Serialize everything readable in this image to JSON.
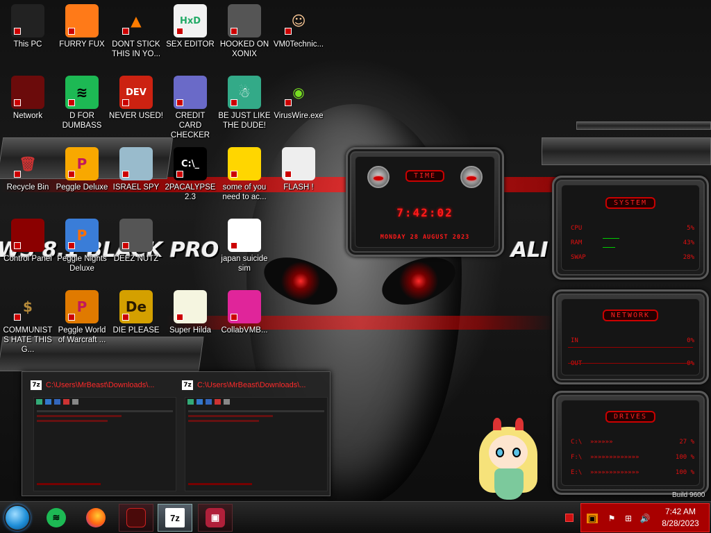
{
  "desktop": {
    "icons": [
      {
        "label": "This PC",
        "icon": "computer-icon",
        "glyph": "",
        "bg": "#222",
        "fg": "#fff"
      },
      {
        "label": "FURRY FUX",
        "icon": "firefox-icon",
        "glyph": "",
        "bg": "#ff7a18",
        "fg": "#fff"
      },
      {
        "label": "DONT STICK THIS IN YO...",
        "icon": "traffic-cone-icon",
        "glyph": "▲",
        "bg": "transparent",
        "fg": "#ff7c00"
      },
      {
        "label": "SEX EDITOR",
        "icon": "hex-editor-icon",
        "glyph": "HxD",
        "bg": "#f2f2f2",
        "fg": "#2a6"
      },
      {
        "label": "HOOKED ON XONIX",
        "icon": "xonix-game-icon",
        "glyph": "",
        "bg": "#555",
        "fg": "#fff"
      },
      {
        "label": "VM0Technic...",
        "icon": "doctor-user-icon",
        "glyph": "☺",
        "bg": "transparent",
        "fg": "#fc9"
      },
      {
        "label": "Network",
        "icon": "network-icon",
        "glyph": "",
        "bg": "#6b0b0b",
        "fg": "#f33"
      },
      {
        "label": "D FOR DUMBASS",
        "icon": "spotify-icon",
        "glyph": "≋",
        "bg": "#1db954",
        "fg": "#000"
      },
      {
        "label": "NEVER USED!",
        "icon": "dev-cpp-icon",
        "glyph": "DEV",
        "bg": "#c21",
        "fg": "#fff"
      },
      {
        "label": "CREDIT CARD CHECKER",
        "icon": "credit-card-icon",
        "glyph": "",
        "bg": "#6a6ac8",
        "fg": "#fff"
      },
      {
        "label": "BE JUST LIKE THE DUDE!",
        "icon": "elf-icon",
        "glyph": "☃",
        "bg": "#3a8",
        "fg": "#fff"
      },
      {
        "label": "VirusWire.exe",
        "icon": "limewire-icon",
        "glyph": "◉",
        "bg": "transparent",
        "fg": "#7d2"
      },
      {
        "label": "Recycle Bin",
        "icon": "recycle-bin-icon",
        "glyph": "🗑",
        "bg": "transparent",
        "fg": "#c33"
      },
      {
        "label": "Peggle Deluxe",
        "icon": "peggle-icon",
        "glyph": "P",
        "bg": "#f8a800",
        "fg": "#c2185b"
      },
      {
        "label": "ISRAEL SPY",
        "icon": "spy-network-icon",
        "glyph": "",
        "bg": "#9bc",
        "fg": "#fff"
      },
      {
        "label": "2PACALYPSE 2.3",
        "icon": "terminal-icon",
        "glyph": "C:\\_",
        "bg": "#000",
        "fg": "#fff"
      },
      {
        "label": "some of you need to ac...",
        "icon": "beaver-icon",
        "glyph": "",
        "bg": "#ffd600",
        "fg": "#7a3b0a"
      },
      {
        "label": "FLASH !",
        "icon": "flash-document-icon",
        "glyph": "",
        "bg": "#eee",
        "fg": "#c00"
      },
      {
        "label": "Control Panel",
        "icon": "control-panel-icon",
        "glyph": "",
        "bg": "#8b0000",
        "fg": "#fff"
      },
      {
        "label": "Peggle Nights Deluxe",
        "icon": "peggle-nights-icon",
        "glyph": "P",
        "bg": "#3a7dd8",
        "fg": "#ff6f00"
      },
      {
        "label": "DEEZ NUTZ",
        "icon": "stacked-windows-icon",
        "glyph": "",
        "bg": "#555",
        "fg": "#ddd"
      },
      {
        "label": "japan suicide sim",
        "icon": "japanese-document-icon",
        "glyph": "",
        "bg": "#fff",
        "fg": "#333"
      },
      {
        "label": "COMMUNISTS HATE THIS G...",
        "icon": "money-bag-icon",
        "glyph": "$",
        "bg": "transparent",
        "fg": "#b58a3a"
      },
      {
        "label": "Peggle World of Warcraft ...",
        "icon": "peggle-wow-icon",
        "glyph": "P",
        "bg": "#e07a00",
        "fg": "#c2185b"
      },
      {
        "label": "DIE PLEASE",
        "icon": "adobe-de-icon",
        "glyph": "De",
        "bg": "#d4a000",
        "fg": "#2a1a00"
      },
      {
        "label": "Super Hilda",
        "icon": "pixel-character-icon",
        "glyph": "",
        "bg": "#f5f5e0",
        "fg": "#333"
      },
      {
        "label": "CollabVMB...",
        "icon": "collabvm-icon",
        "glyph": "",
        "bg": "#e0259a",
        "fg": "#fff"
      }
    ]
  },
  "widgets": {
    "time": {
      "title": "TIME",
      "clock": "7:42:02",
      "date": "MONDAY 28 AUGUST 2023"
    },
    "system": {
      "title": "SYSTEM",
      "rows": [
        {
          "label": "CPU",
          "value": "5%"
        },
        {
          "label": "RAM",
          "value": "43%"
        },
        {
          "label": "SWAP",
          "value": "28%"
        }
      ]
    },
    "network": {
      "title": "NETWORK",
      "rows": [
        {
          "label": "IN",
          "value": "0%"
        },
        {
          "label": "OUT",
          "value": "0%"
        }
      ]
    },
    "drives": {
      "title": "DRIVES",
      "rows": [
        {
          "label": "C:\\",
          "value": "27 %"
        },
        {
          "label": "F:\\",
          "value": "100 %"
        },
        {
          "label": "E:\\",
          "value": "100 %"
        }
      ]
    }
  },
  "wallpaper": {
    "left_text": "WS 8.1 BLACK PRO",
    "right_text": "ALI",
    "build": "Build 9600"
  },
  "thumbnails": [
    {
      "title": "C:\\Users\\MrBeast\\Downloads\\..."
    },
    {
      "title": "C:\\Users\\MrBeast\\Downloads\\..."
    }
  ],
  "taskbar": {
    "pins": [
      {
        "name": "spotify",
        "icon": "spotify-icon",
        "glyph": "≋",
        "state": ""
      },
      {
        "name": "firefox",
        "icon": "firefox-icon",
        "glyph": "",
        "state": ""
      },
      {
        "name": "red-app",
        "icon": "red-app-icon",
        "glyph": "",
        "state": "running"
      },
      {
        "name": "7zip",
        "icon": "7zip-icon",
        "glyph": "7z",
        "state": "active"
      },
      {
        "name": "media-app",
        "icon": "media-app-icon",
        "glyph": "▣",
        "state": "running"
      }
    ],
    "clock_time": "7:42 AM",
    "clock_date": "8/28/2023"
  }
}
